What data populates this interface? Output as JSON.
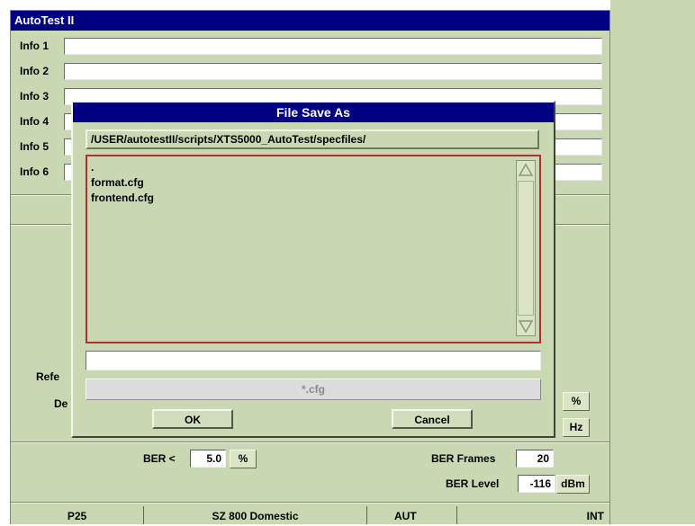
{
  "window": {
    "title": "AutoTest II"
  },
  "info_rows": [
    {
      "label": "Info 1",
      "value": ""
    },
    {
      "label": "Info 2",
      "value": ""
    },
    {
      "label": "Info 3",
      "value": ""
    },
    {
      "label": "Info 4",
      "value": ""
    },
    {
      "label": "Info 5",
      "value": ""
    },
    {
      "label": "Info 6",
      "value": ""
    }
  ],
  "middle": {
    "ref_label_partial": "Refe",
    "dev_label_partial": "De",
    "unit_percent": "%",
    "unit_hz": "Hz"
  },
  "ber": {
    "ber_label": "BER <",
    "ber_value": "5.0",
    "ber_unit": "%",
    "frames_label": "BER Frames",
    "frames_value": "20",
    "level_label": "BER Level",
    "level_value": "-116",
    "level_unit": "dBm"
  },
  "status_bar": {
    "mode": "P25",
    "system": "SZ 800 Domestic",
    "aut": "AUT",
    "int": "INT"
  },
  "dialog": {
    "title": "File Save As",
    "path": "/USER/autotestII/scripts/XTS5000_AutoTest/specfiles/",
    "files": [
      ".",
      "format.cfg",
      "frontend.cfg"
    ],
    "filename_value": "",
    "filter": "*.cfg",
    "ok_label": "OK",
    "cancel_label": "Cancel"
  },
  "colors": {
    "titlebar": "#000080",
    "panel": "#c9d7b3",
    "list_border": "#b03030"
  }
}
